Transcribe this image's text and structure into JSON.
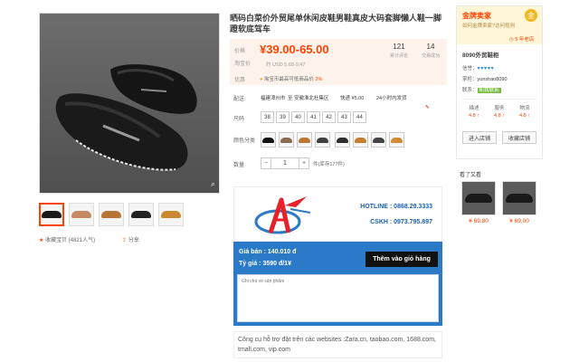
{
  "title": "晒码白菜价外贸尾单休闲皮鞋男鞋真皮大码套脚懒人鞋一脚蹬软底驾车",
  "price": {
    "label": "价格",
    "label2": "淘宝价",
    "value": "¥39.00-65.00",
    "usd": "约 USD 5.68-9.47",
    "promo_label": "优惠",
    "promo_text": "淘宝币最高可抵商品价",
    "promo_pct": "2%",
    "stats": [
      {
        "num": "121",
        "label": "累计评论"
      },
      {
        "num": "14",
        "label": "交易成功"
      }
    ]
  },
  "shipping": {
    "label": "配送",
    "from": "福建漳州市",
    "to": "至 安徽淮北杜集区",
    "method": "快递 ¥5.00",
    "time": "24小时内发货"
  },
  "sizes": {
    "label": "尺码",
    "items": [
      "38",
      "39",
      "40",
      "41",
      "42",
      "43",
      "44"
    ]
  },
  "colors": {
    "label": "颜色分类",
    "swatches": [
      "#111111",
      "#8a6b52",
      "#b9772f",
      "#3f3f3f",
      "#2d2d2d",
      "#c47d2f",
      "#444444",
      "#d08a33"
    ]
  },
  "quantity": {
    "label": "数量",
    "minus": "−",
    "value": "1",
    "plus": "+",
    "stock": "件(库存177件)"
  },
  "gallery": {
    "zoom_icon": "search-icon",
    "thumbs": [
      "#1a1a1a",
      "#c58a66",
      "#b87435",
      "#222222",
      "#c98830"
    ],
    "favorites": "收藏宝贝 (4821人气)",
    "share": "分享"
  },
  "widget": {
    "hotline_label": "HOTLINE : 0868.29.3333",
    "cskh_label": "CSKH : 0973.795.897",
    "gia_ban": "Giá bán : 140.010 đ",
    "ty_gia": "Tỷ giá : 3590 đ/1¥",
    "add_cart": "Thêm vào giỏ hàng",
    "note_placeholder": "Ghi chú về sản phẩm",
    "support_text": "Công cụ hỗ trợ đặt trên các websites :Zara.cn, taobao.com, 1688.com, tmall.com, vip.com",
    "brand_colors": {
      "blue": "#2b7ac7",
      "red": "#e8202a"
    }
  },
  "shop": {
    "gold_title": "金牌卖家",
    "gold_sub": "如何金牌卖家?访问规则",
    "years": "5 年老店",
    "name": "8090外贸鞋柜",
    "credit_label": "信誉：",
    "credit_hearts": "♥♥♥♥♥",
    "owner_label": "掌柜：",
    "owner": "yunshao8090",
    "contact_label": "联系：",
    "contact": "和我联系",
    "scores": [
      {
        "label": "描述",
        "value": "4.8 ↑"
      },
      {
        "label": "服务",
        "value": "4.8 ↑"
      },
      {
        "label": "物流",
        "value": "4.8 ↑"
      }
    ],
    "btn_enter": "进入店铺",
    "btn_fav": "收藏店铺"
  },
  "see_also": {
    "header": "看了又看",
    "items": [
      {
        "price": "¥ 69.80"
      },
      {
        "price": "¥ 69.00"
      }
    ]
  }
}
